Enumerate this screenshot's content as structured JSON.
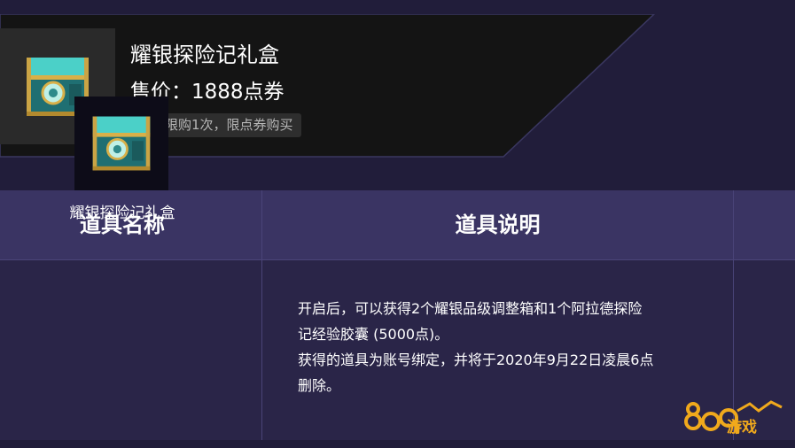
{
  "header": {
    "item_title": "耀银探险记礼盒",
    "price": "售价：1888点券",
    "limit": "账号限购1次，限点券购买"
  },
  "table": {
    "columns": [
      "道具名称",
      "道具说明"
    ],
    "rows": [
      {
        "name": "耀银探险记礼盒",
        "icon": "treasure-chest-icon",
        "description": [
          "开启后，可以获得2个耀银品级调整箱和1个阿拉德探险",
          "记经验胶囊 (5000点)。",
          "获得的道具为账号绑定，并将于2020年9月22日凌晨6点",
          "删除。"
        ]
      }
    ]
  },
  "watermark": {
    "text": "游戏",
    "logo": "8090-logo"
  },
  "colors": {
    "background": "#211d3a",
    "banner": "#141414",
    "table_header": "#3a3463",
    "table_body": "#2a2548",
    "watermark": "#f0a91c"
  }
}
